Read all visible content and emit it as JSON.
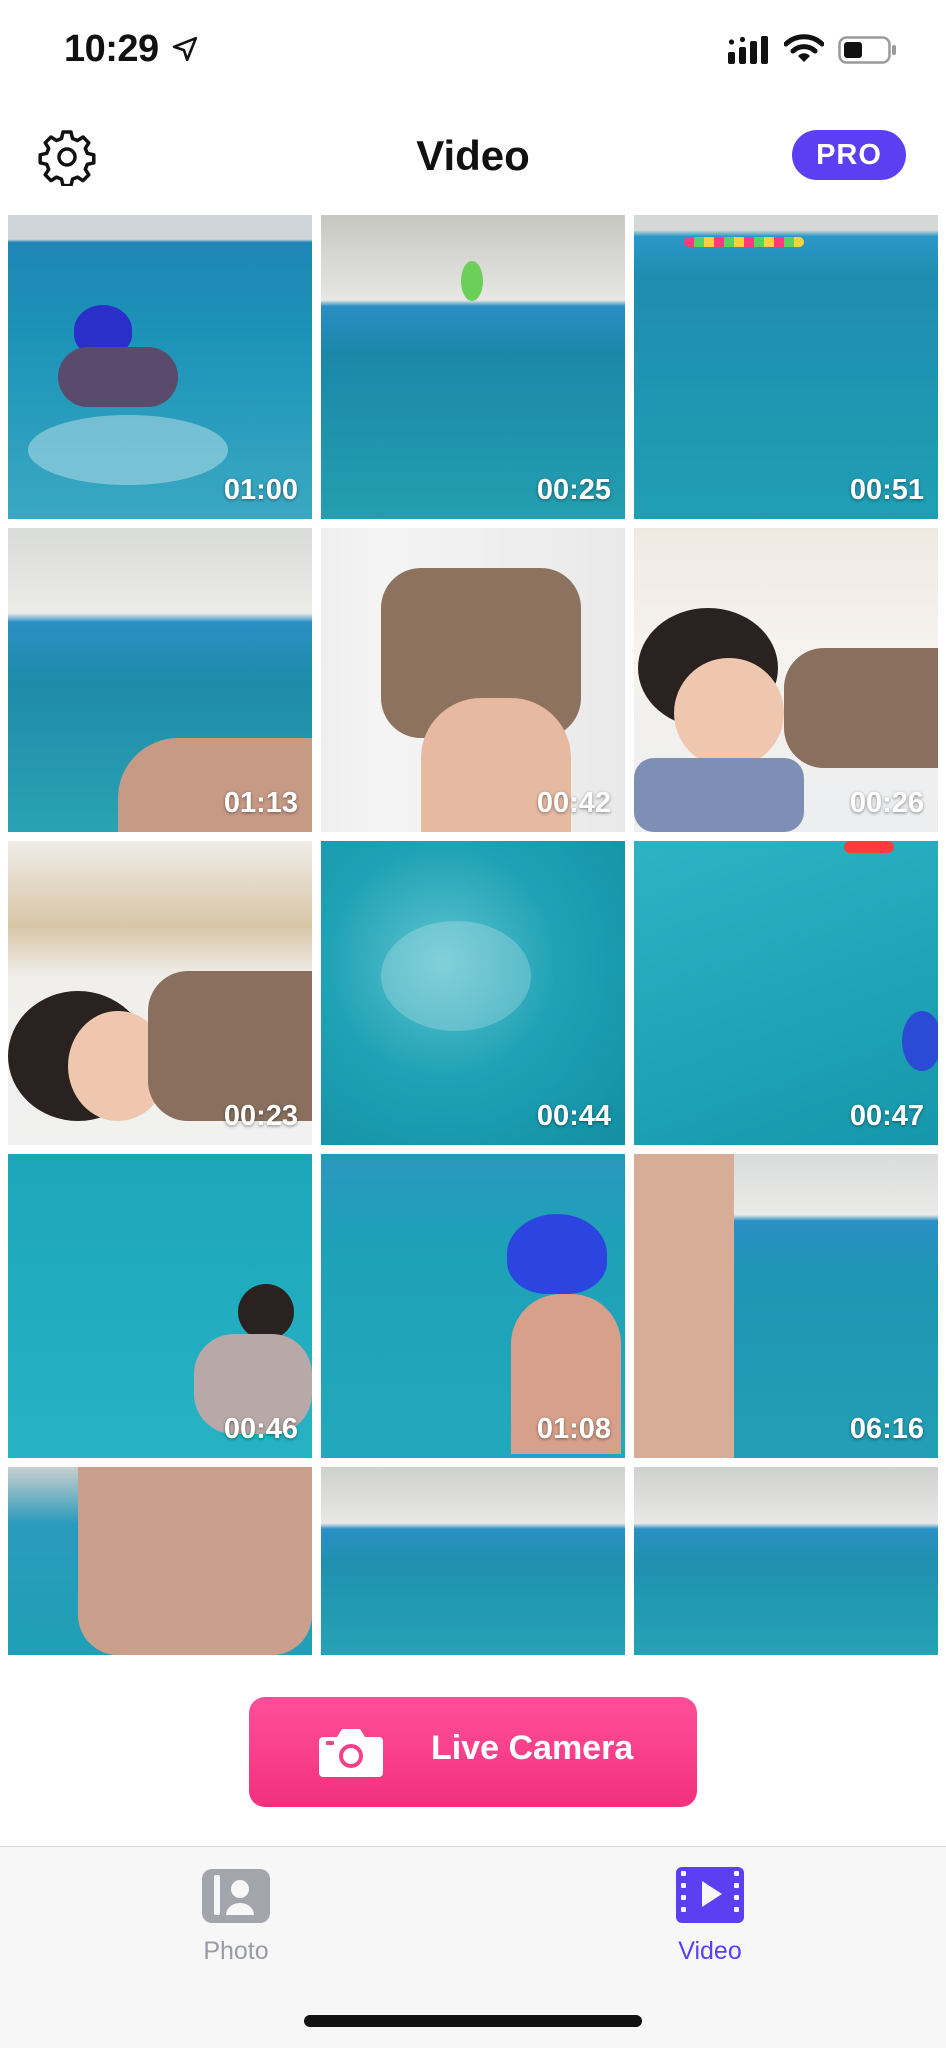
{
  "status_bar": {
    "time": "10:29"
  },
  "header": {
    "title": "Video",
    "pro_label": "PRO"
  },
  "videos": [
    {
      "duration": "01:00",
      "scene": "swimmer-blue-cap"
    },
    {
      "duration": "00:25",
      "scene": "pool-wide"
    },
    {
      "duration": "00:51",
      "scene": "pool-water"
    },
    {
      "duration": "01:13",
      "scene": "pool-wide-arm"
    },
    {
      "duration": "00:42",
      "scene": "child-upside-down"
    },
    {
      "duration": "00:26",
      "scene": "child-lying"
    },
    {
      "duration": "00:23",
      "scene": "child-lying-room"
    },
    {
      "duration": "00:44",
      "scene": "water-splash"
    },
    {
      "duration": "00:47",
      "scene": "water-hand"
    },
    {
      "duration": "00:46",
      "scene": "child-swimming"
    },
    {
      "duration": "01:08",
      "scene": "swimmer-blue-cap-back"
    },
    {
      "duration": "06:16",
      "scene": "man-in-pool"
    },
    {
      "duration": "",
      "scene": "man-closeup"
    },
    {
      "duration": "",
      "scene": "pool-far"
    },
    {
      "duration": "",
      "scene": "pool-far-2"
    }
  ],
  "live_camera": {
    "label": "Live Camera"
  },
  "tabs": [
    {
      "label": "Photo",
      "active": false
    },
    {
      "label": "Video",
      "active": true
    }
  ],
  "colors": {
    "accent": "#5b3ff0",
    "live_button": "#f2307e",
    "inactive_tab": "#9a9ca5"
  }
}
